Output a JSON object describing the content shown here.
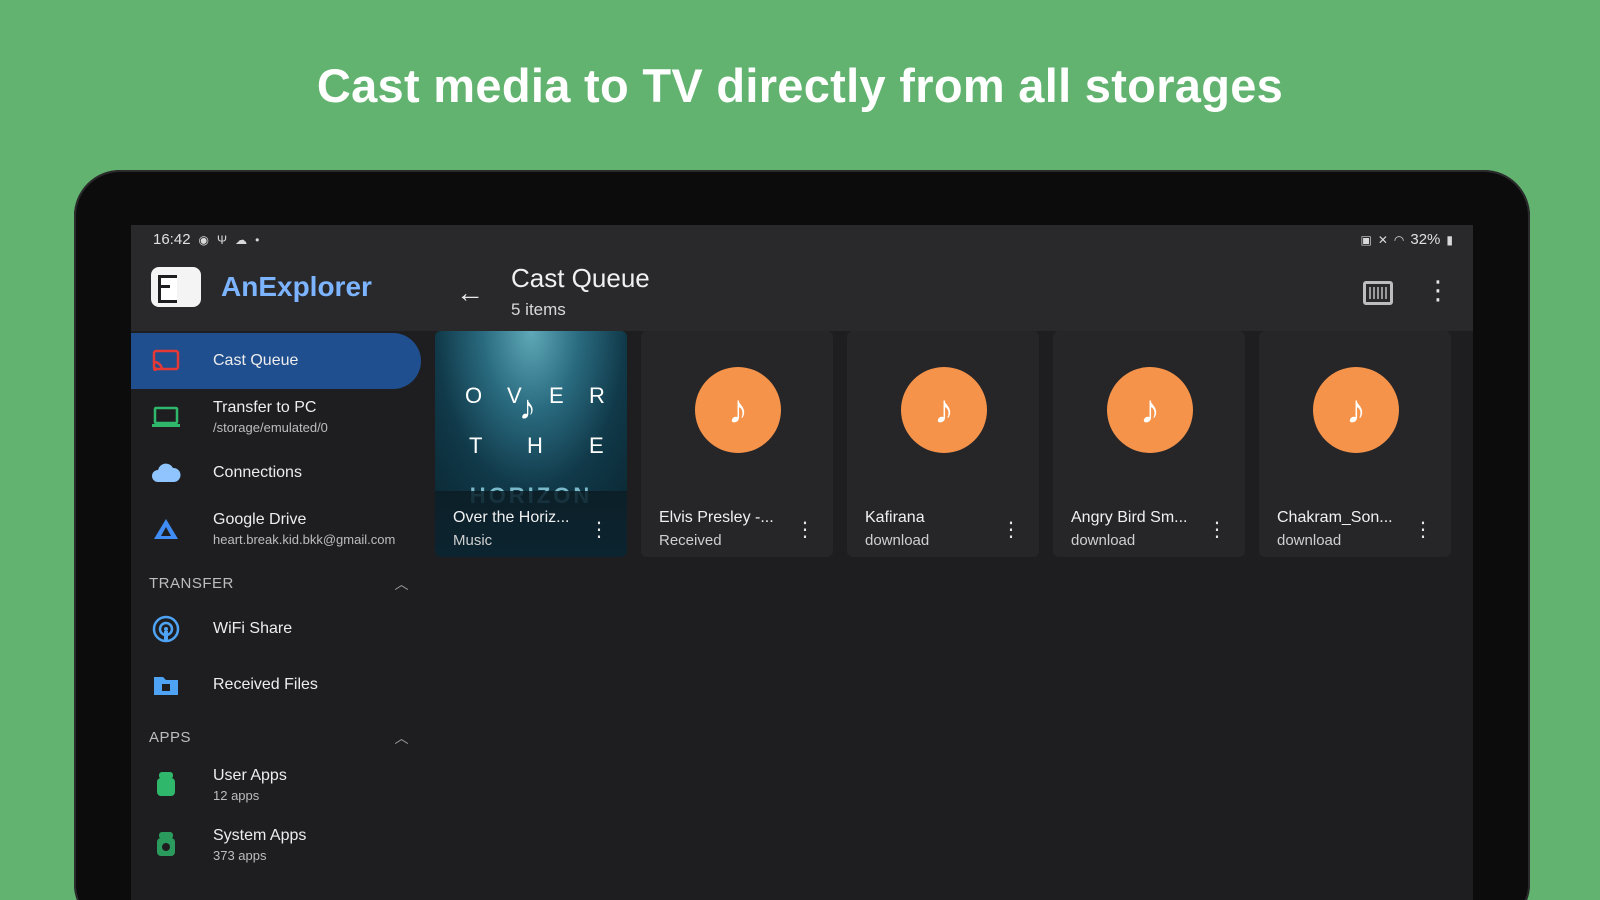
{
  "headline": "Cast media to TV directly from all storages",
  "status_bar": {
    "time": "16:42",
    "left_icons": [
      "notification-icon",
      "usb-icon",
      "cloud-icon"
    ],
    "dot": "•",
    "battery": "32%"
  },
  "app": {
    "name": "AnExplorer",
    "title": "Cast Queue",
    "subtitle": "5 items",
    "back_glyph": "←",
    "more_glyph": "⋮"
  },
  "sidebar": {
    "items": [
      {
        "label": "Cast Queue",
        "sub": "",
        "icon": "cast-icon",
        "color": "#e53935",
        "active": true
      },
      {
        "label": "Transfer to PC",
        "sub": "/storage/emulated/0",
        "icon": "monitor-icon",
        "color": "#2fb86b"
      },
      {
        "label": "Connections",
        "sub": "",
        "icon": "cloud-icon",
        "color": "#8fc4ff"
      },
      {
        "label": "Google Drive",
        "sub": "heart.break.kid.bkk@gmail.com",
        "icon": "drive-icon",
        "color": "#3f8cf4"
      }
    ],
    "sections": [
      {
        "title": "TRANSFER",
        "items": [
          {
            "label": "WiFi Share",
            "sub": "",
            "icon": "wifi-share-icon",
            "color": "#4ea3f5"
          },
          {
            "label": "Received Files",
            "sub": "",
            "icon": "folder-icon",
            "color": "#4ea3f5"
          }
        ]
      },
      {
        "title": "APPS",
        "items": [
          {
            "label": "User Apps",
            "sub": "12 apps",
            "icon": "android-icon",
            "color": "#2fb86b"
          },
          {
            "label": "System Apps",
            "sub": "373 apps",
            "icon": "android-icon",
            "color": "#2a9b5c"
          }
        ]
      }
    ]
  },
  "cards": [
    {
      "name": "Over the Horiz...",
      "sub": "Music",
      "type": "album"
    },
    {
      "name": "Elvis Presley -...",
      "sub": "Received",
      "type": "music"
    },
    {
      "name": "Kafirana",
      "sub": "download",
      "type": "music"
    },
    {
      "name": "Angry Bird Sm...",
      "sub": "download",
      "type": "music"
    },
    {
      "name": "Chakram_Son...",
      "sub": "download",
      "type": "music"
    }
  ],
  "album_art": {
    "letters_row1": [
      "O",
      "V",
      "E",
      "R"
    ],
    "letters_row2": [
      "T",
      "H",
      "E"
    ],
    "word": "HORIZON"
  },
  "music_glyph": "♪",
  "menu_glyph": "⋮",
  "accent": {
    "music": "#f6934a",
    "active_nav": "#1f4f8f",
    "brand": "#7db4ff",
    "background": "#62b36f"
  }
}
